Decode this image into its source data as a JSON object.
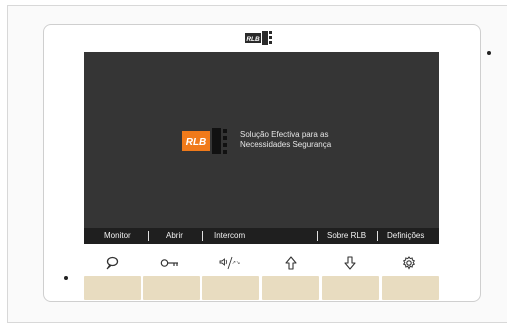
{
  "splash": {
    "logo_text": "RLB",
    "line1": "Solução Efectiva para as",
    "line2": "Necessidades Segurança"
  },
  "menu": {
    "items": [
      {
        "label": "Monitor"
      },
      {
        "label": "Abrir"
      },
      {
        "label": "Intercom"
      },
      {
        "label": "Sobre RLB"
      },
      {
        "label": "Definições"
      }
    ]
  },
  "icons": [
    {
      "name": "monitor-icon"
    },
    {
      "name": "key-icon"
    },
    {
      "name": "intercom-volume-icon"
    },
    {
      "name": "arrow-up-icon"
    },
    {
      "name": "arrow-down-icon"
    },
    {
      "name": "gear-icon"
    }
  ],
  "colors": {
    "screen": "#353535",
    "menu_bar": "#1f1f1f",
    "key_beige": "#e8dcc0",
    "logo_orange": "#f07a1a"
  }
}
